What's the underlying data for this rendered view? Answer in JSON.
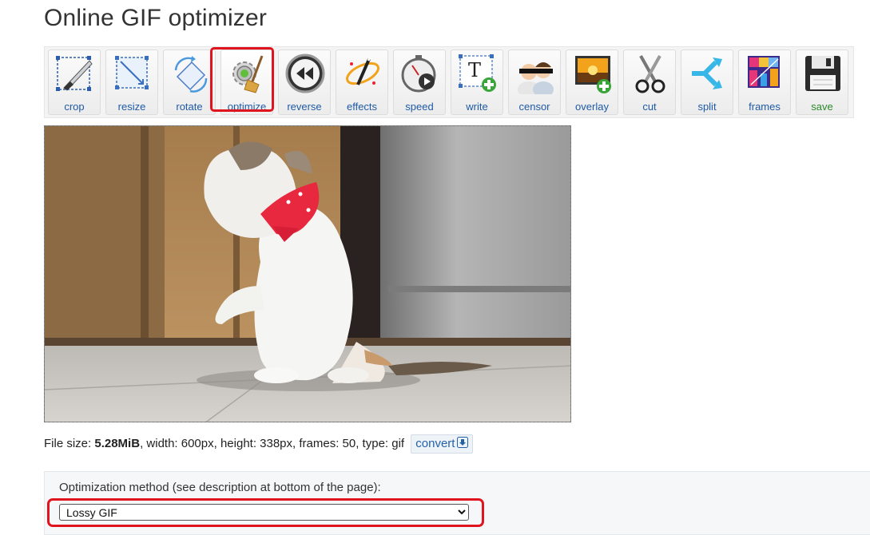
{
  "page": {
    "title": "Online GIF optimizer"
  },
  "toolbar": {
    "items": [
      {
        "label": "crop",
        "icon": "crop-icon"
      },
      {
        "label": "resize",
        "icon": "resize-icon"
      },
      {
        "label": "rotate",
        "icon": "rotate-icon"
      },
      {
        "label": "optimize",
        "icon": "optimize-icon"
      },
      {
        "label": "reverse",
        "icon": "reverse-icon"
      },
      {
        "label": "effects",
        "icon": "effects-icon"
      },
      {
        "label": "speed",
        "icon": "speed-icon"
      },
      {
        "label": "write",
        "icon": "write-icon"
      },
      {
        "label": "censor",
        "icon": "censor-icon"
      },
      {
        "label": "overlay",
        "icon": "overlay-icon"
      },
      {
        "label": "cut",
        "icon": "cut-icon"
      },
      {
        "label": "split",
        "icon": "split-icon"
      },
      {
        "label": "frames",
        "icon": "frames-icon"
      },
      {
        "label": "save",
        "icon": "save-icon"
      }
    ],
    "active": "optimize",
    "highlight_color": "#e0141e"
  },
  "preview": {
    "subject": "cat-gif",
    "colors": {
      "wall": "#b4895a",
      "floor": "#c9c6c1",
      "fridge": "#8e8e8e",
      "bandana": "#e8283f"
    }
  },
  "file_info": {
    "size_label": "File size:",
    "size_value": "5.28MiB",
    "details": ", width: 600px, height: 338px, frames: 50, type: gif",
    "convert_label": "convert"
  },
  "optimization": {
    "label": "Optimization method (see description at bottom of the page):",
    "selected": "Lossy GIF"
  }
}
